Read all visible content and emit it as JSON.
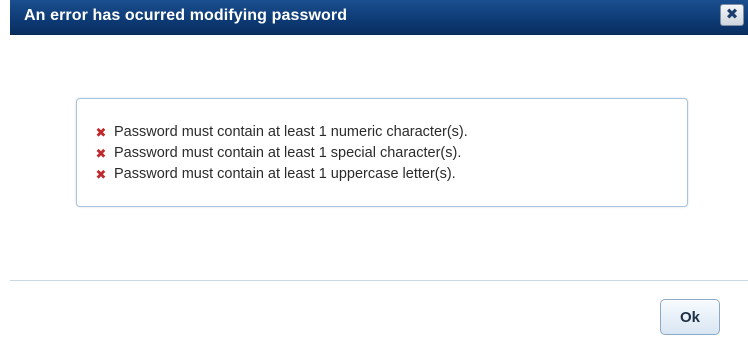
{
  "dialog": {
    "title": "An error has ocurred modifying password",
    "close_icon": "close-icon",
    "close_label": "✖"
  },
  "errors": {
    "icon": "error-x-icon",
    "icon_color": "#c0282b",
    "icon_glyph": "✖",
    "items": [
      {
        "text": "Password must contain at least 1 numeric character(s)."
      },
      {
        "text": "Password must contain at least 1 special character(s)."
      },
      {
        "text": "Password must contain at least 1 uppercase letter(s)."
      }
    ]
  },
  "footer": {
    "ok_label": "Ok"
  },
  "colors": {
    "titlebar": "#0d3a74",
    "box_border": "#a9c3dc",
    "button_border": "#8aaac8"
  }
}
